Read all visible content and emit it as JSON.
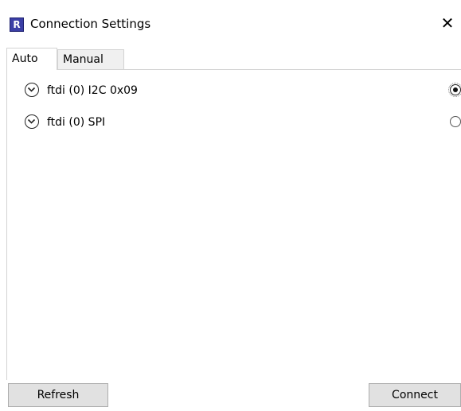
{
  "window": {
    "title": "Connection Settings",
    "icon_letter": "R",
    "close_glyph": "✕"
  },
  "tabs": [
    {
      "label": "Auto",
      "selected": true
    },
    {
      "label": "Manual",
      "selected": false
    }
  ],
  "connections": [
    {
      "label": "ftdi (0) I2C 0x09",
      "selected": true
    },
    {
      "label": "ftdi (0) SPI",
      "selected": false
    }
  ],
  "buttons": {
    "refresh": "Refresh",
    "connect": "Connect"
  },
  "icons": {
    "app": "app-icon",
    "close": "close-icon",
    "expand": "chevron-down-circle-icon"
  },
  "colors": {
    "app_icon_bg": "#3b3fa6",
    "button_bg": "#e1e1e1",
    "tab_inactive_bg": "#f0f0f0"
  }
}
